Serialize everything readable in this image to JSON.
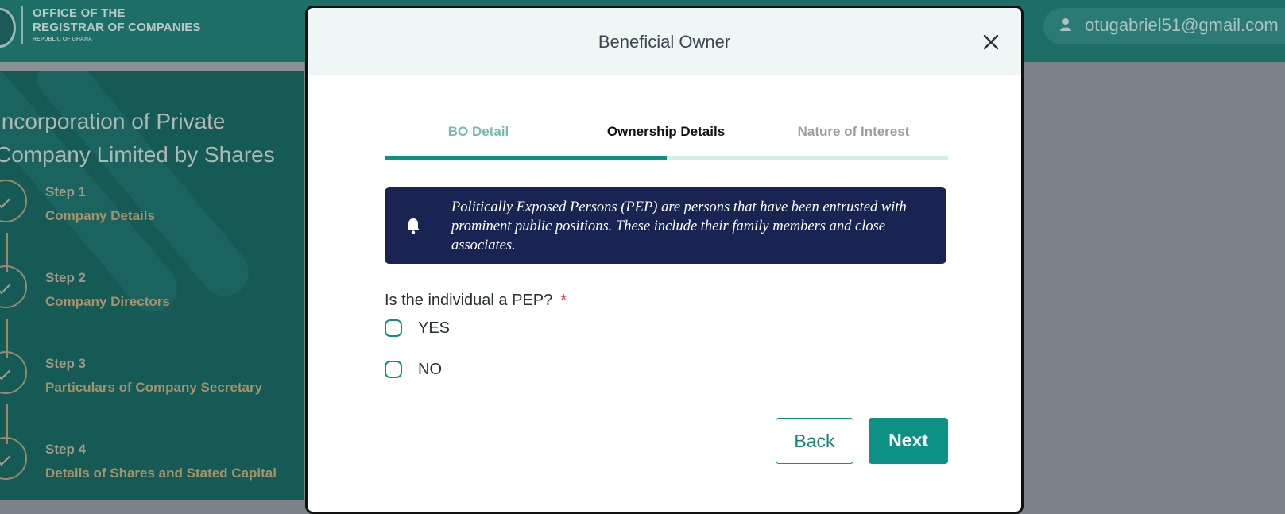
{
  "header": {
    "org_line1": "OFFICE OF THE",
    "org_line2": "REGISTRAR OF COMPANIES",
    "org_line3": "REPUBLIC OF GHANA",
    "user_email": "otugabriel51@gmail.com",
    "user_icon": "user-icon"
  },
  "wizard": {
    "title_line1": "Incorporation of Private",
    "title_line2": "Company Limited by Shares",
    "steps": [
      {
        "num": "Step 1",
        "name": "Company Details"
      },
      {
        "num": "Step 2",
        "name": "Company Directors"
      },
      {
        "num": "Step 3",
        "name": "Particulars of Company Secretary"
      },
      {
        "num": "Step 4",
        "name": "Details of Shares and Stated Capital"
      }
    ]
  },
  "modal": {
    "title": "Beneficial Owner",
    "close_icon": "close-icon",
    "tabs": [
      {
        "label": "BO Detail",
        "state": "completed"
      },
      {
        "label": "Ownership Details",
        "state": "active"
      },
      {
        "label": "Nature of Interest",
        "state": "pending"
      }
    ],
    "progress_fraction": 0.5,
    "alert": {
      "icon": "bell-icon",
      "text": "Politically Exposed Persons (PEP) are persons that have been entrusted with prominent public positions. These include their family members and close associates."
    },
    "question": "Is the individual a PEP?",
    "required_marker": "*",
    "options": [
      {
        "label": "YES",
        "checked": false
      },
      {
        "label": "NO",
        "checked": false
      }
    ],
    "buttons": {
      "back": "Back",
      "next": "Next"
    }
  },
  "colors": {
    "accent": "#0d9185",
    "alert_bg": "#1a2452",
    "header_bg": "#eff7f6"
  }
}
